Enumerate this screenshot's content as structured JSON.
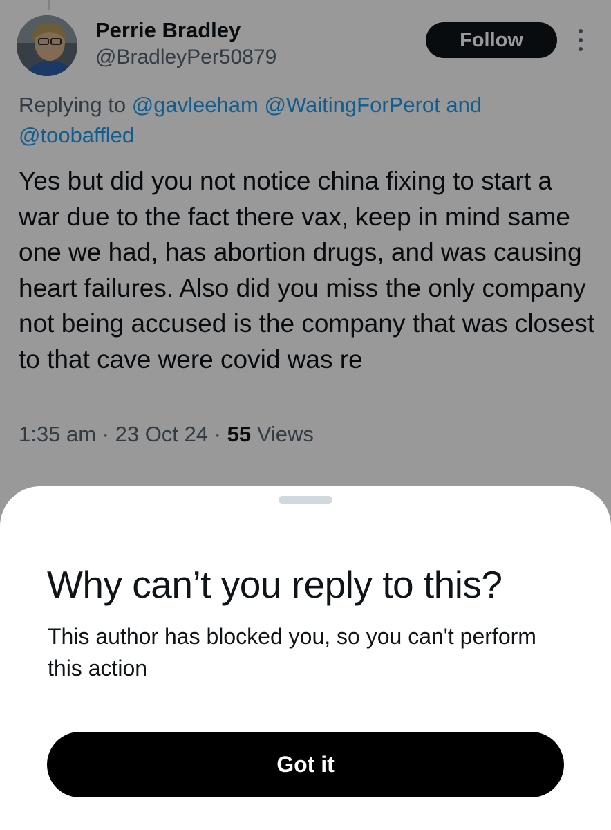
{
  "tweet": {
    "author_name": "Perrie Bradley",
    "author_handle": "@BradleyPer50879",
    "follow_label": "Follow",
    "replying_prefix": "Replying to",
    "reply_mention_1": "@gavleeham",
    "reply_mention_2": "@WaitingForPerot",
    "reply_and": "and",
    "reply_mention_3": "@toobaffled",
    "text": "Yes but did you not notice china fixing to start a war due to the fact there vax, keep in mind same one we had, has abortion drugs, and was causing heart failures. Also did you miss the only company not being accused is the company that was closest to that cave were covid was re",
    "time": "1:35 am",
    "date": "23 Oct 24",
    "separator": "·",
    "views_count": "55",
    "views_label": "Views"
  },
  "sheet": {
    "title": "Why can’t you reply to this?",
    "body": "This author has blocked you, so you can't perform this action",
    "button_label": "Got it"
  },
  "colors": {
    "text_primary": "#0f1419",
    "text_secondary": "#536471",
    "link": "#1d9bf0",
    "overlay": "rgba(0,0,0,0.4)",
    "button_bg": "#000000"
  },
  "icons": {
    "more": "more-vertical-icon"
  }
}
